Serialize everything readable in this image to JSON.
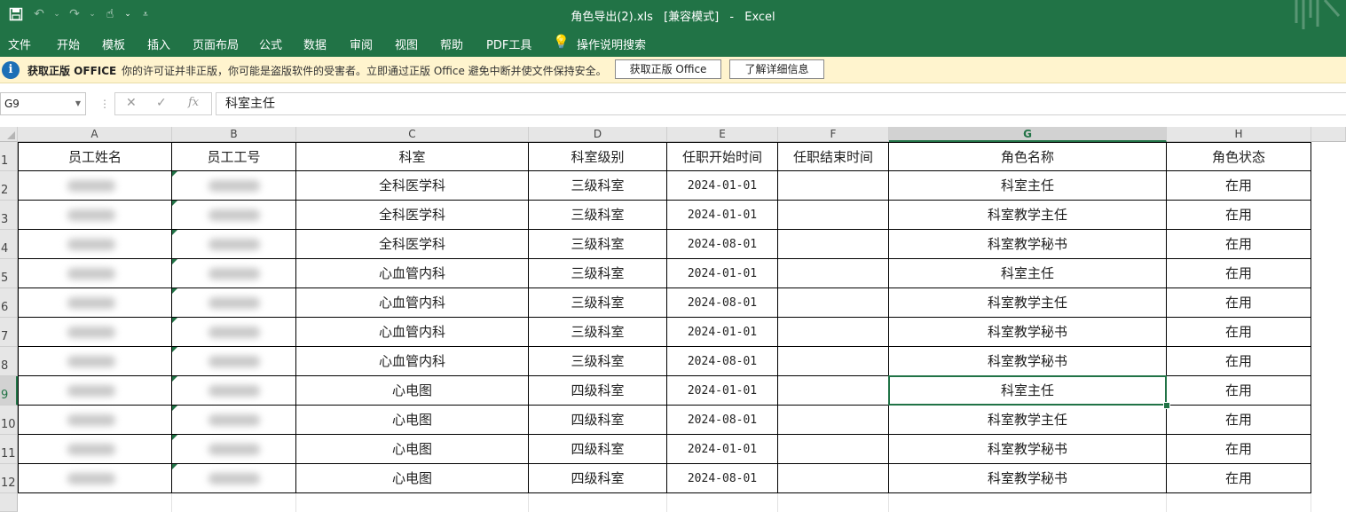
{
  "window": {
    "title": "角色导出(2).xls",
    "mode": "[兼容模式]",
    "separator": "-",
    "app": "Excel"
  },
  "ribbon": {
    "tabs": [
      "文件",
      "开始",
      "模板",
      "插入",
      "页面布局",
      "公式",
      "数据",
      "审阅",
      "视图",
      "帮助",
      "PDF工具"
    ],
    "tell_me": "操作说明搜索"
  },
  "notice": {
    "title": "获取正版 OFFICE",
    "message": "你的许可证并非正版，你可能是盗版软件的受害者。立即通过正版 Office 避免中断并使文件保持安全。",
    "button_get": "获取正版 Office",
    "button_learn": "了解详细信息"
  },
  "formula_bar": {
    "name_box": "G9",
    "content": "科室主任"
  },
  "sheet": {
    "columns": [
      "A",
      "B",
      "C",
      "D",
      "E",
      "F",
      "G",
      "H"
    ],
    "selected_column": "G",
    "selected_row": 9,
    "header_row": [
      "员工姓名",
      "员工工号",
      "科室",
      "科室级别",
      "任职开始时间",
      "任职结束时间",
      "角色名称",
      "角色状态"
    ],
    "rows": [
      {
        "dept": "全科医学科",
        "level": "三级科室",
        "start": "2024-01-01",
        "end": "",
        "role": "科室主任",
        "status": "在用"
      },
      {
        "dept": "全科医学科",
        "level": "三级科室",
        "start": "2024-01-01",
        "end": "",
        "role": "科室教学主任",
        "status": "在用"
      },
      {
        "dept": "全科医学科",
        "level": "三级科室",
        "start": "2024-08-01",
        "end": "",
        "role": "科室教学秘书",
        "status": "在用"
      },
      {
        "dept": "心血管内科",
        "level": "三级科室",
        "start": "2024-01-01",
        "end": "",
        "role": "科室主任",
        "status": "在用"
      },
      {
        "dept": "心血管内科",
        "level": "三级科室",
        "start": "2024-08-01",
        "end": "",
        "role": "科室教学主任",
        "status": "在用"
      },
      {
        "dept": "心血管内科",
        "level": "三级科室",
        "start": "2024-01-01",
        "end": "",
        "role": "科室教学秘书",
        "status": "在用"
      },
      {
        "dept": "心血管内科",
        "level": "三级科室",
        "start": "2024-08-01",
        "end": "",
        "role": "科室教学秘书",
        "status": "在用"
      },
      {
        "dept": "心电图",
        "level": "四级科室",
        "start": "2024-01-01",
        "end": "",
        "role": "科室主任",
        "status": "在用"
      },
      {
        "dept": "心电图",
        "level": "四级科室",
        "start": "2024-08-01",
        "end": "",
        "role": "科室教学主任",
        "status": "在用"
      },
      {
        "dept": "心电图",
        "level": "四级科室",
        "start": "2024-01-01",
        "end": "",
        "role": "科室教学秘书",
        "status": "在用"
      },
      {
        "dept": "心电图",
        "level": "四级科室",
        "start": "2024-08-01",
        "end": "",
        "role": "科室教学秘书",
        "status": "在用"
      }
    ]
  },
  "colors": {
    "accent": "#217346",
    "notice_bg": "#fff4ce",
    "info_icon": "#1c6fb6"
  }
}
